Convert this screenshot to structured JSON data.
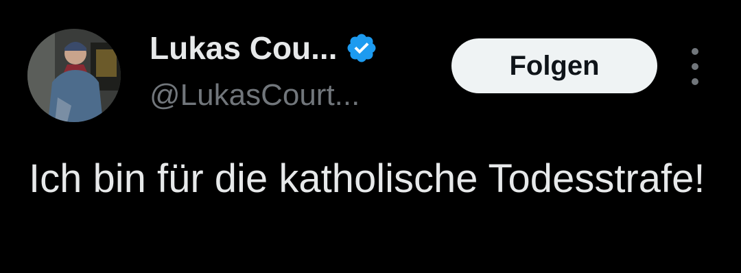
{
  "user": {
    "display_name": "Lukas Cou...",
    "handle": "@LukasCourt...",
    "verified": true,
    "verified_icon": "verified-badge-icon",
    "verified_color": "#1d9bf0"
  },
  "actions": {
    "follow_label": "Folgen",
    "more_icon": "more-vertical-icon"
  },
  "tweet": {
    "text": "Ich bin für die katholische Todesstrafe!"
  },
  "colors": {
    "background": "#000000",
    "primary_text": "#e7e9ea",
    "secondary_text": "#71767b",
    "button_bg": "#eff3f4",
    "button_text": "#0f1419"
  }
}
